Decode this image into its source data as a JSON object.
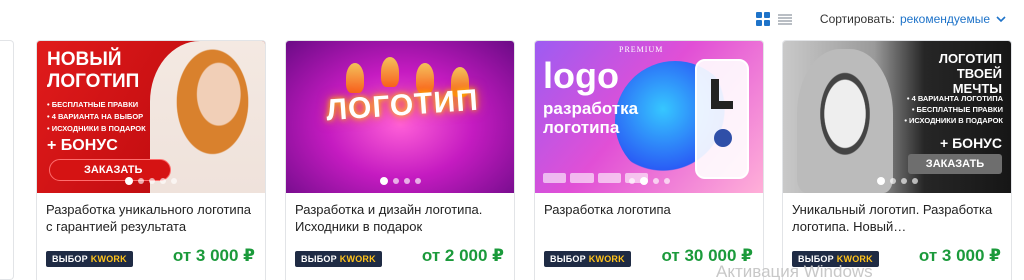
{
  "toolbar": {
    "sort_label": "Сортировать:",
    "sort_value": "рекомендуемые",
    "view_grid_icon": "grid-view-icon",
    "view_list_icon": "list-view-icon"
  },
  "colors": {
    "accent": "#1e73c9",
    "price": "#1b9a3b",
    "badge_bg": "#1f2b44",
    "badge_accent": "#ffc21a"
  },
  "cards": [
    {
      "image": {
        "headline_1": "НОВЫЙ",
        "headline_2": "ЛОГОТИП",
        "bullets": [
          "• БЕСПЛАТНЫЕ ПРАВКИ",
          "• 4 ВАРИАНТА НА ВЫБОР",
          "• ИСХОДНИКИ В ПОДАРОК"
        ],
        "bonus": "+ БОНУС",
        "cta": "ЗАКАЗАТЬ"
      },
      "title": "Разработка уникального логотипа с гарантией результата",
      "badge_1": "ВЫБОР",
      "badge_2": "KWORK",
      "price": "от 3 000 ₽"
    },
    {
      "image": {
        "word": "ЛОГОТИП"
      },
      "title": "Разработка и дизайн логотипа. Исходники в подарок",
      "badge_1": "ВЫБОР",
      "badge_2": "KWORK",
      "price": "от 2 000 ₽"
    },
    {
      "image": {
        "premium": "PREMIUM",
        "logo": "logo",
        "sub_1": "разработка",
        "sub_2": "логотипа"
      },
      "title": "Разработка логотипа",
      "badge_1": "ВЫБОР",
      "badge_2": "KWORK",
      "price": "от 30 000 ₽"
    },
    {
      "image": {
        "headline_1": "ЛОГОТИП",
        "headline_2": "ТВОЕЙ МЕЧТЫ",
        "bullets": [
          "• 4 ВАРИАНТА ЛОГОТИПА",
          "• БЕСПЛАТНЫЕ ПРАВКИ",
          "• ИСХОДНИКИ В ПОДАРОК"
        ],
        "bonus": "+ БОНУС",
        "cta": "ЗАКАЗАТЬ"
      },
      "title": "Уникальный логотип. Разработка логотипа. Новый…",
      "badge_1": "ВЫБОР",
      "badge_2": "KWORK",
      "price": "от 3 000 ₽"
    }
  ],
  "watermark": "Активация Windows"
}
